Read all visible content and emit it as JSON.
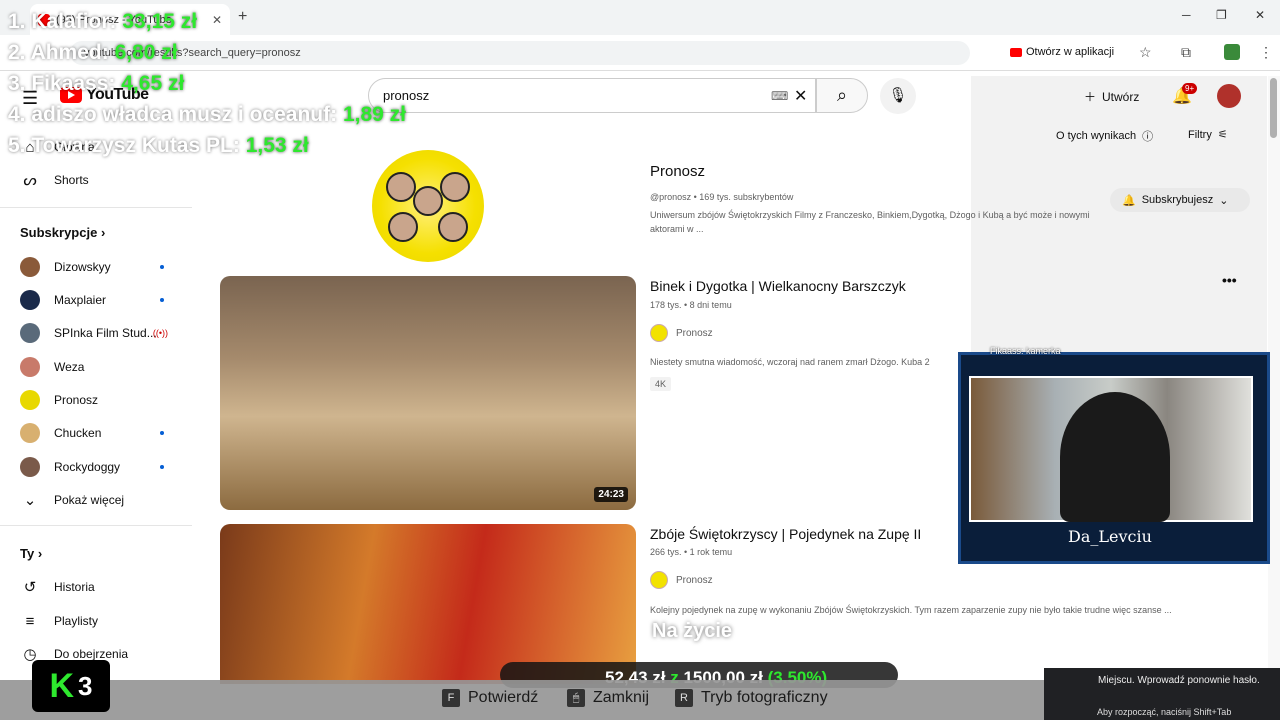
{
  "browser": {
    "tab_title": "(95) Pronosz - YouTube",
    "url": "youtube.com/results?search_query=pronosz",
    "open_in_app": "Otwórz w aplikacji"
  },
  "youtube": {
    "logo_text": "YouTube",
    "search_value": "pronosz",
    "create_label": "Utwórz",
    "notification_count": "9+",
    "about_results": "O tych wynikach",
    "filters": "Filtry"
  },
  "sidebar": {
    "top_items": [
      {
        "label": "Główna"
      },
      {
        "label": "Shorts"
      }
    ],
    "subscriptions_title": "Subskrypcje",
    "subscriptions": [
      {
        "label": "Dizowskyy"
      },
      {
        "label": "Maxplaier"
      },
      {
        "label": "SPInka Film Stud..."
      },
      {
        "label": "Weza"
      },
      {
        "label": "Pronosz"
      },
      {
        "label": "Chucken"
      },
      {
        "label": "Rockydoggy"
      }
    ],
    "show_more": "Pokaż więcej",
    "you_title": "Ty",
    "you_items": [
      {
        "label": "Historia"
      },
      {
        "label": "Playlisty"
      },
      {
        "label": "Do obejrzenia"
      }
    ]
  },
  "channel": {
    "name": "Pronosz",
    "meta": "@pronosz • 169 tys. subskrybentów",
    "description": "Uniwersum zbójów Świętokrzyskich Filmy z Franczesko, Binkiem,Dygotką, Dżogo i Kubą a być może i nowymi aktorami w ...",
    "subscribed_label": "Subskrybujesz"
  },
  "videos": [
    {
      "title": "Binek i Dygotka | Wielkanocny Barszczyk",
      "meta": "178 tys. • 8 dni temu",
      "channel": "Pronosz",
      "description": "Niestety smutna wiadomość, wczoraj nad ranem zmarł Dżogo. Kuba 2",
      "badge": "4K",
      "duration": "24:23"
    },
    {
      "title": "Zbóje Świętokrzyscy | Pojedynek na Zupę II",
      "meta": "266 tys. • 1 rok temu",
      "channel": "Pronosz",
      "description": "Kolejny pojedynek na zupę w wykonaniu Zbójów Świętokrzyskich. Tym razem zaparzenie zupy nie było takie trudne więc szanse ..."
    }
  ],
  "overlay": {
    "leaderboard": [
      {
        "name": "1. Kalafior:",
        "amount": "33,15 zł"
      },
      {
        "name": "2. Ahmed:",
        "amount": "6,80 zł"
      },
      {
        "name": "3. Fikaass:",
        "amount": "4,65 zł"
      },
      {
        "name": "4. adiszo władca musz i oceanuf:",
        "amount": "1,89 zł"
      },
      {
        "name": "5. Towarzysz Kutas PL:",
        "amount": "1,53 zł"
      }
    ],
    "cam_name": "Da_Levciu",
    "cam_label": "Fikaass: kamerka",
    "caption": "Na życie",
    "goal_current": "52,43 zł",
    "goal_separator": "z",
    "goal_target": "1500,00 zł",
    "goal_percent": "(3.50%)",
    "logo_letter": "K",
    "logo_number": "3"
  },
  "game_bar": {
    "hints": [
      {
        "key": "F",
        "label": "Potwierdź"
      },
      {
        "key": "🖱",
        "label": "Zamknij"
      },
      {
        "key": "R",
        "label": "Tryb fotograficzny"
      }
    ],
    "notification": "Miejscu. Wprowadź ponownie hasło.",
    "start_hint": "Aby rozpocząć, naciśnij Shift+Tab"
  }
}
